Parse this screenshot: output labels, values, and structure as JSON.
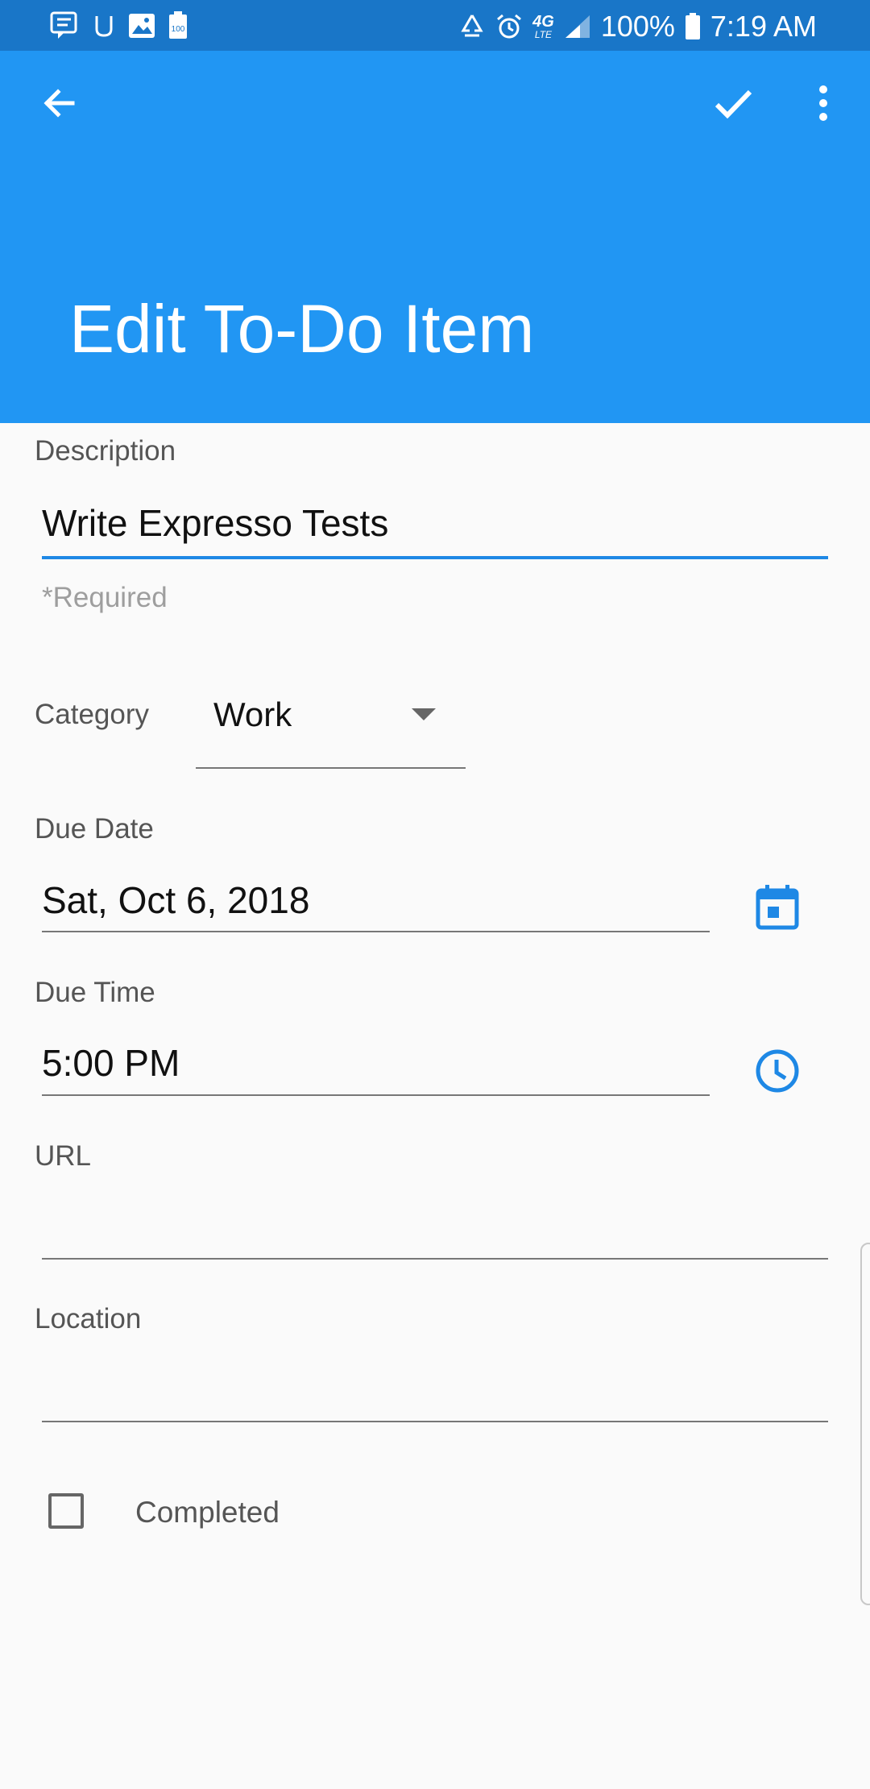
{
  "status_bar": {
    "battery_text": "100%",
    "time": "7:19 AM",
    "network": "4G",
    "network_sub": "LTE",
    "storage_badge": "100"
  },
  "app_bar": {
    "title": "Edit To-Do Item"
  },
  "form": {
    "description": {
      "label": "Description",
      "value": "Write Expresso Tests",
      "helper": "*Required"
    },
    "category": {
      "label": "Category",
      "value": "Work"
    },
    "due_date": {
      "label": "Due Date",
      "value": "Sat, Oct 6, 2018"
    },
    "due_time": {
      "label": "Due Time",
      "value": "5:00 PM"
    },
    "url": {
      "label": "URL",
      "value": ""
    },
    "location": {
      "label": "Location",
      "value": ""
    },
    "completed": {
      "label": "Completed",
      "checked": false
    }
  },
  "colors": {
    "status_bar": "#1976c8",
    "app_bar": "#2196f3",
    "accent": "#1e88e5",
    "background": "#fafafa"
  }
}
